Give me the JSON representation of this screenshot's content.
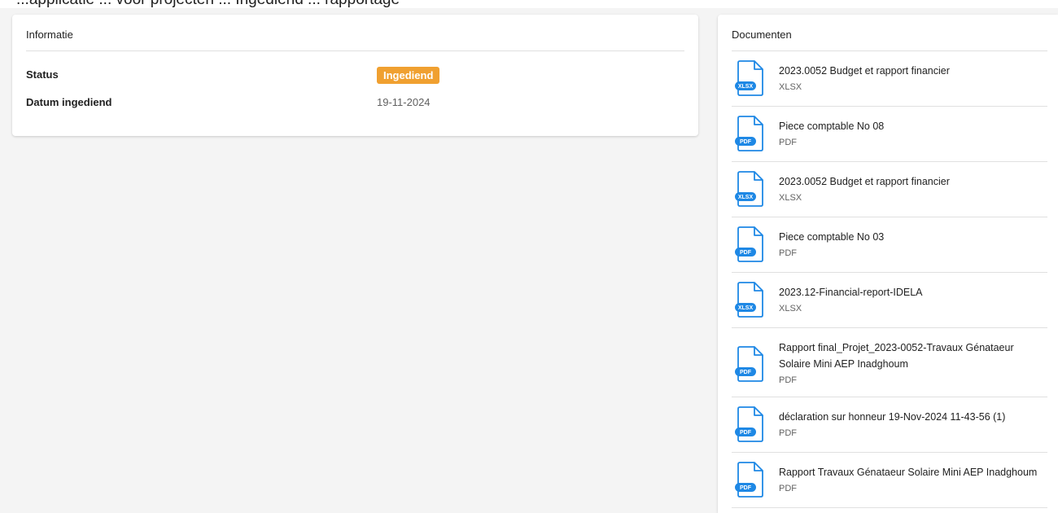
{
  "page_header": {
    "cut_off_text": "...applicatie ... voor projecten ... Ingediend ... rapportage"
  },
  "info": {
    "title": "Informatie",
    "status_label": "Status",
    "status_value": "Ingediend",
    "date_label": "Datum ingediend",
    "date_value": "19-11-2024"
  },
  "documents": {
    "title": "Documenten",
    "items": [
      {
        "name": "2023.0052 Budget et rapport financier",
        "type": "XLSX",
        "icon_tag": "XLSX"
      },
      {
        "name": "Piece comptable No 08",
        "type": "PDF",
        "icon_tag": "PDF"
      },
      {
        "name": "2023.0052 Budget et rapport financier",
        "type": "XLSX",
        "icon_tag": "XLSX"
      },
      {
        "name": "Piece comptable No 03",
        "type": "PDF",
        "icon_tag": "PDF"
      },
      {
        "name": "2023.12-Financial-report-IDELA",
        "type": "XLSX",
        "icon_tag": "XLSX"
      },
      {
        "name": "Rapport final_Projet_2023-0052-Travaux Génataeur Solaire Mini AEP Inadghoum",
        "type": "PDF",
        "icon_tag": "PDF"
      },
      {
        "name": "déclaration sur honneur 19-Nov-2024 11-43-56 (1)",
        "type": "PDF",
        "icon_tag": "PDF"
      },
      {
        "name": "Rapport Travaux Génataeur Solaire Mini AEP Inadghoum",
        "type": "PDF",
        "icon_tag": "PDF"
      }
    ]
  },
  "colors": {
    "badge": "#f0a030",
    "icon_blue": "#1e88e5",
    "background": "#f4f4f4"
  }
}
